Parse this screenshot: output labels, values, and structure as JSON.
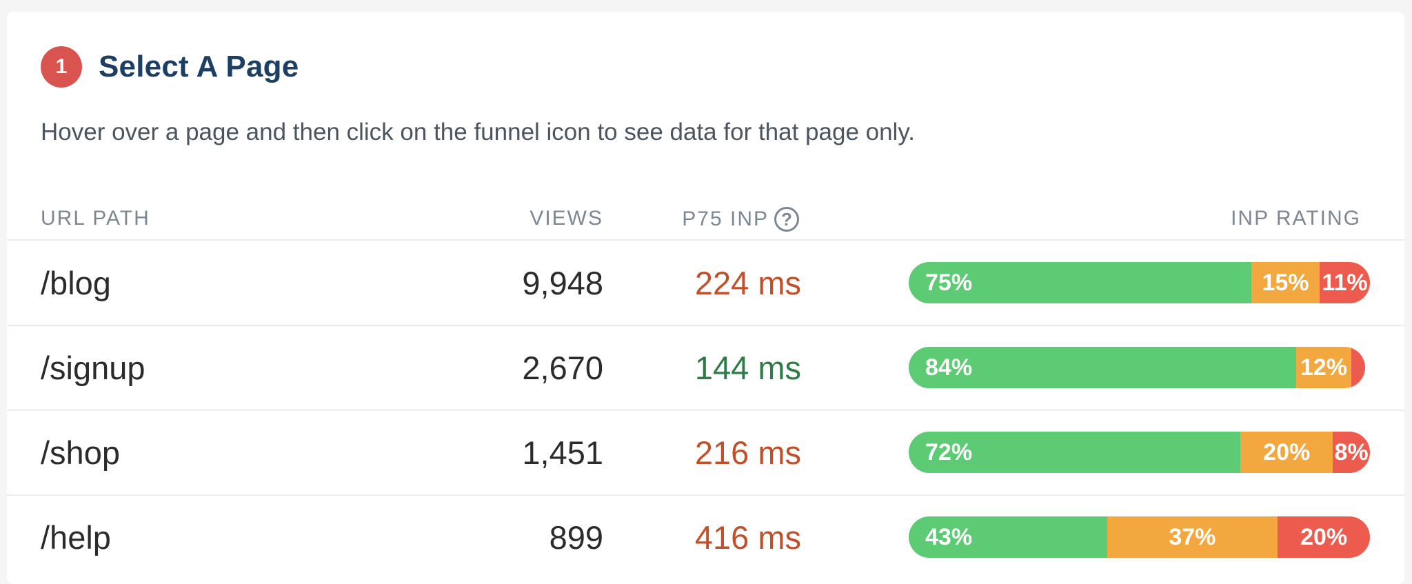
{
  "step": {
    "number": "1",
    "title": "Select A Page",
    "badge_color": "#d9534f"
  },
  "subtitle": "Hover over a page and then click on the funnel icon to see data for that page only.",
  "columns": {
    "url_path": "URL PATH",
    "views": "VIEWS",
    "p75_inp": "P75 INP",
    "inp_rating": "INP RATING",
    "help_icon": "question-circle-icon"
  },
  "colors": {
    "good": "#5ccb74",
    "needs_improvement": "#f2a83e",
    "poor": "#ed5b4f",
    "inp_text_poor": "#c1502a",
    "inp_text_good": "#2e7d46"
  },
  "rows": [
    {
      "url": "/blog",
      "views": "9,948",
      "p75_inp": "224 ms",
      "inp_status": "poor",
      "rating": {
        "good": {
          "pct": 75,
          "label": "75%"
        },
        "mid": {
          "pct": 15,
          "label": "15%"
        },
        "poor": {
          "pct": 11,
          "label": "11%"
        }
      }
    },
    {
      "url": "/signup",
      "views": "2,670",
      "p75_inp": "144 ms",
      "inp_status": "good",
      "rating": {
        "good": {
          "pct": 84,
          "label": "84%"
        },
        "mid": {
          "pct": 12,
          "label": "12%"
        },
        "poor": {
          "pct": 3,
          "label": ""
        }
      }
    },
    {
      "url": "/shop",
      "views": "1,451",
      "p75_inp": "216 ms",
      "inp_status": "poor",
      "rating": {
        "good": {
          "pct": 72,
          "label": "72%"
        },
        "mid": {
          "pct": 20,
          "label": "20%"
        },
        "poor": {
          "pct": 8,
          "label": "8%"
        }
      }
    },
    {
      "url": "/help",
      "views": "899",
      "p75_inp": "416 ms",
      "inp_status": "poor",
      "rating": {
        "good": {
          "pct": 43,
          "label": "43%"
        },
        "mid": {
          "pct": 37,
          "label": "37%"
        },
        "poor": {
          "pct": 20,
          "label": "20%"
        }
      }
    }
  ]
}
